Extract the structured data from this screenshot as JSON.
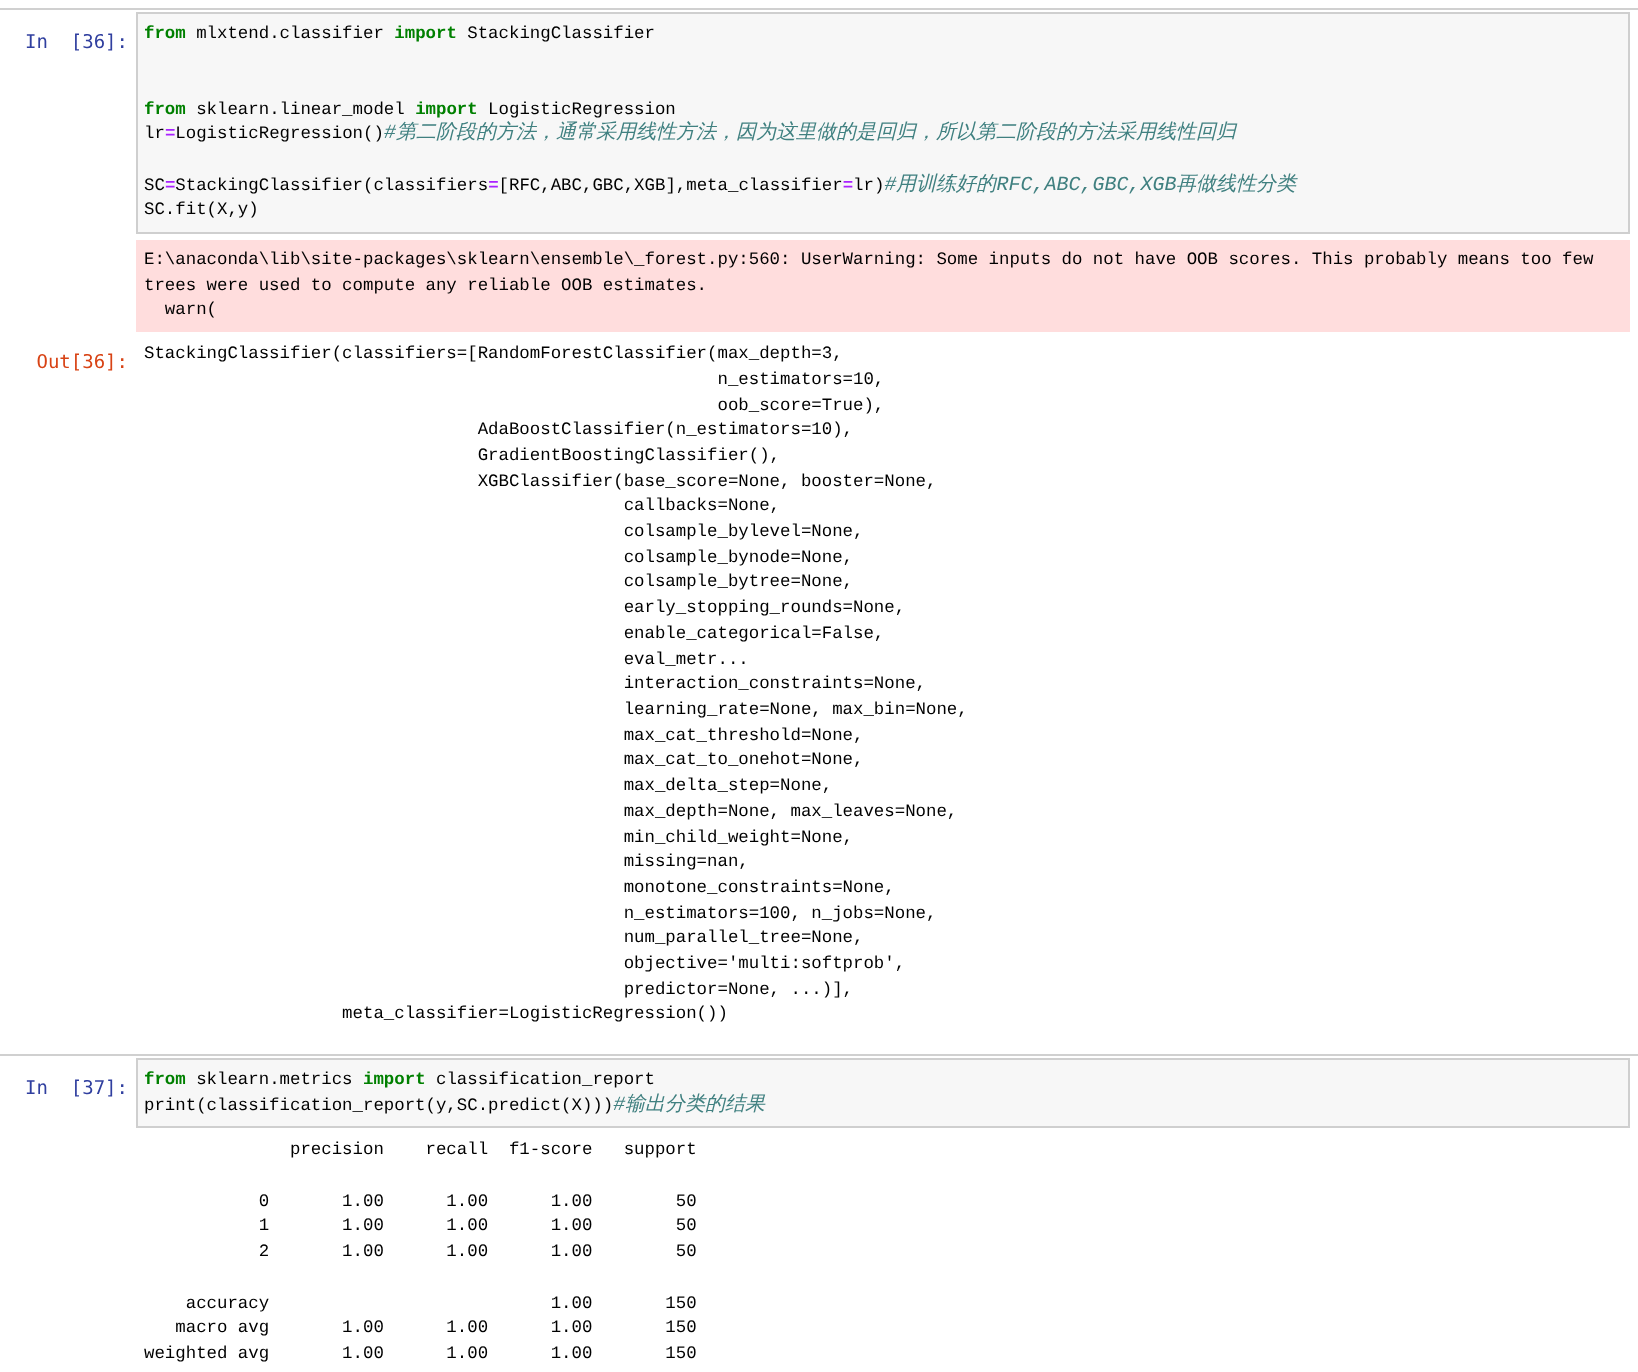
{
  "cells": [
    {
      "prompt": "In  [36]:",
      "lines": [
        {
          "kind": "code",
          "tokens": [
            {
              "kind": "keyword",
              "text": "from"
            },
            {
              "kind": "plain",
              "text": " mlxtend.classifier "
            },
            {
              "kind": "keyword",
              "text": "import"
            },
            {
              "kind": "plain",
              "text": " StackingClassifier"
            }
          ]
        },
        {
          "kind": "blank"
        },
        {
          "kind": "blank"
        },
        {
          "kind": "code",
          "tokens": [
            {
              "kind": "keyword",
              "text": "from"
            },
            {
              "kind": "plain",
              "text": " sklearn.linear_model "
            },
            {
              "kind": "keyword",
              "text": "import"
            },
            {
              "kind": "plain",
              "text": " LogisticRegression"
            }
          ]
        },
        {
          "kind": "code",
          "tokens": [
            {
              "kind": "plain",
              "text": "lr"
            },
            {
              "kind": "operator",
              "text": "="
            },
            {
              "kind": "plain",
              "text": "LogisticRegression()"
            },
            {
              "kind": "comment",
              "text": "#第二阶段的方法，通常采用线性方法，因为这里做的是回归，所以第二阶段的方法采用线性回归"
            }
          ]
        },
        {
          "kind": "blank"
        },
        {
          "kind": "code",
          "tokens": [
            {
              "kind": "plain",
              "text": "SC"
            },
            {
              "kind": "operator",
              "text": "="
            },
            {
              "kind": "plain",
              "text": "StackingClassifier(classifiers"
            },
            {
              "kind": "operator",
              "text": "="
            },
            {
              "kind": "plain",
              "text": "[RFC,ABC,GBC,XGB],meta_classifier"
            },
            {
              "kind": "operator",
              "text": "="
            },
            {
              "kind": "plain",
              "text": "lr)"
            },
            {
              "kind": "comment",
              "text": "#用训练好的RFC,ABC,GBC,XGB再做线性分类"
            }
          ]
        },
        {
          "kind": "code",
          "tokens": [
            {
              "kind": "plain",
              "text": "SC.fit(X,y)"
            }
          ]
        }
      ],
      "stderr": "E:\\anaconda\\lib\\site-packages\\sklearn\\ensemble\\_forest.py:560: UserWarning: Some inputs do not have OOB scores. This probably means too few\ntrees were used to compute any reliable OOB estimates.\n  warn(",
      "out_prompt": "Out[36]:",
      "output": "StackingClassifier(classifiers=[RandomForestClassifier(max_depth=3,\n                                                       n_estimators=10,\n                                                       oob_score=True),\n                                AdaBoostClassifier(n_estimators=10),\n                                GradientBoostingClassifier(),\n                                XGBClassifier(base_score=None, booster=None,\n                                              callbacks=None,\n                                              colsample_bylevel=None,\n                                              colsample_bynode=None,\n                                              colsample_bytree=None,\n                                              early_stopping_rounds=None,\n                                              enable_categorical=False,\n                                              eval_metr...\n                                              interaction_constraints=None,\n                                              learning_rate=None, max_bin=None,\n                                              max_cat_threshold=None,\n                                              max_cat_to_onehot=None,\n                                              max_delta_step=None,\n                                              max_depth=None, max_leaves=None,\n                                              min_child_weight=None,\n                                              missing=nan,\n                                              monotone_constraints=None,\n                                              n_estimators=100, n_jobs=None,\n                                              num_parallel_tree=None,\n                                              objective='multi:softprob',\n                                              predictor=None, ...)],\n                   meta_classifier=LogisticRegression())"
    },
    {
      "prompt": "In  [37]:",
      "lines": [
        {
          "kind": "code",
          "tokens": [
            {
              "kind": "keyword",
              "text": "from"
            },
            {
              "kind": "plain",
              "text": " sklearn.metrics "
            },
            {
              "kind": "keyword",
              "text": "import"
            },
            {
              "kind": "plain",
              "text": " classification_report"
            }
          ]
        },
        {
          "kind": "code",
          "tokens": [
            {
              "kind": "plain",
              "text": "print(classification_report(y,SC.predict(X)))"
            },
            {
              "kind": "comment",
              "text": "#输出分类的结果"
            }
          ]
        }
      ],
      "output": "              precision    recall  f1-score   support\n\n           0       1.00      1.00      1.00        50\n           1       1.00      1.00      1.00        50\n           2       1.00      1.00      1.00        50\n\n    accuracy                           1.00       150\n   macro avg       1.00      1.00      1.00       150\nweighted avg       1.00      1.00      1.00       150"
    }
  ]
}
